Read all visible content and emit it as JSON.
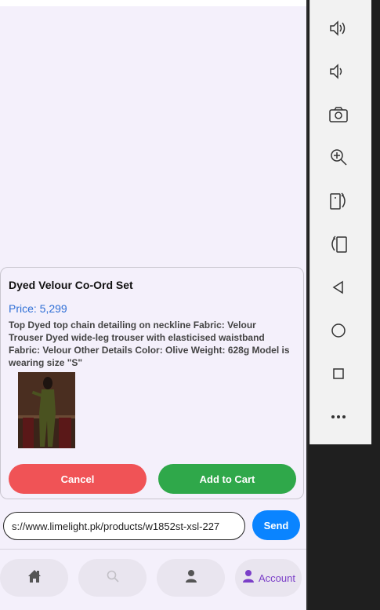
{
  "product": {
    "title": "Dyed Velour Co-Ord Set",
    "price": "Price: 5,299",
    "description": "Top Dyed top chain detailing on neckline Fabric: Velour Trouser Dyed wide-leg trouser with elasticised waistband Fabric: Velour Other Details Color: Olive Weight: 628g Model is wearing size \"S\""
  },
  "actions": {
    "cancel_label": "Cancel",
    "add_label": "Add to Cart"
  },
  "url_bar": {
    "value": "s://www.limelight.pk/products/w1852st-xsl-227",
    "send_label": "Send"
  },
  "nav": {
    "account_label": "Account"
  },
  "colors": {
    "accent": "#7b3fc8",
    "send": "#0a84ff",
    "cancel": "#f05356",
    "add": "#2fa84a",
    "price": "#2f6fd6"
  },
  "side_panel": {
    "icons": [
      "volume-up-icon",
      "volume-down-icon",
      "camera-icon",
      "zoom-in-icon",
      "rotate-left-icon",
      "rotate-right-icon",
      "back-icon",
      "home-icon",
      "overview-icon",
      "more-icon"
    ]
  }
}
